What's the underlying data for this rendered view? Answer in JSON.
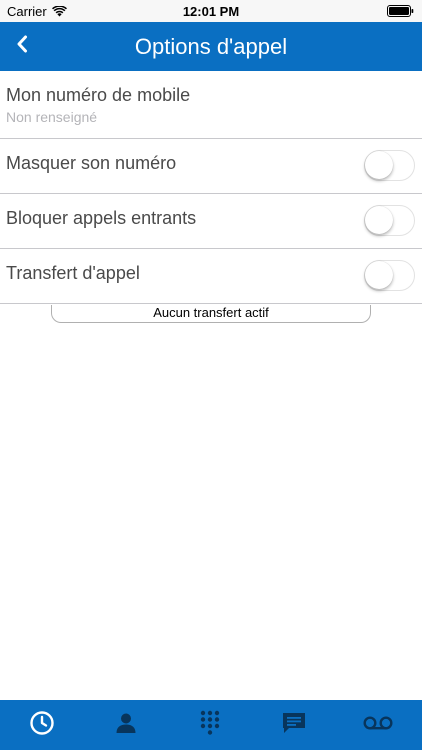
{
  "status_bar": {
    "carrier": "Carrier",
    "time": "12:01 PM"
  },
  "nav": {
    "title": "Options d'appel",
    "back_icon": "chevron-left-icon"
  },
  "settings": {
    "my_number": {
      "label": "Mon numéro de mobile",
      "value": "Non renseigné"
    },
    "hide_number": {
      "label": "Masquer son numéro",
      "enabled": false
    },
    "block_incoming": {
      "label": "Bloquer appels entrants",
      "enabled": false
    },
    "call_forward": {
      "label": "Transfert d'appel",
      "enabled": false
    },
    "forward_status": "Aucun transfert actif"
  },
  "tab_bar": {
    "selected": "history",
    "tabs": [
      {
        "id": "history",
        "icon": "clock-icon"
      },
      {
        "id": "contacts",
        "icon": "person-icon"
      },
      {
        "id": "keypad",
        "icon": "keypad-icon"
      },
      {
        "id": "messages",
        "icon": "chat-bubble-icon"
      },
      {
        "id": "voicemail",
        "icon": "voicemail-icon"
      }
    ]
  },
  "colors": {
    "brand": "#0a6fc2",
    "tab_active": "#ffffff",
    "tab_inactive": "#08355c"
  }
}
